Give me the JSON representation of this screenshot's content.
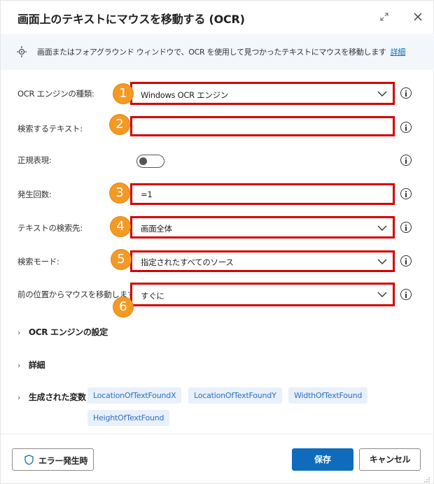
{
  "dialog": {
    "title": "画面上のテキストにマウスを移動する (OCR)",
    "info_text": "画面またはフォアグラウンド ウィンドウで、OCR を使用して見つかったテキストにマウスを移動します",
    "info_link": "詳細"
  },
  "fields": [
    {
      "label": "OCR エンジンの種類:",
      "value": "Windows OCR エンジン",
      "type": "dropdown",
      "badge": "1"
    },
    {
      "label": "検索するテキスト:",
      "value": "",
      "type": "text",
      "badge": "2"
    },
    {
      "label": "正規表現:",
      "value": "",
      "type": "toggle",
      "toggle_on": false
    },
    {
      "label": "発生回数:",
      "value": "=1",
      "type": "text",
      "badge": "3"
    },
    {
      "label": "テキストの検索先:",
      "value": "画面全体",
      "type": "dropdown",
      "badge": "4"
    },
    {
      "label": "検索モード:",
      "value": "指定されたすべてのソース",
      "type": "dropdown",
      "badge": "5"
    },
    {
      "label": "前の位置からマウスを移動します:",
      "value": "すぐに",
      "type": "dropdown",
      "badge": "6"
    }
  ],
  "sections": {
    "ocr_settings": "OCR エンジンの設定",
    "advanced": "詳細",
    "variables": "生成された変数"
  },
  "variables": [
    "LocationOfTextFoundX",
    "LocationOfTextFoundY",
    "WidthOfTextFound",
    "HeightOfTextFound"
  ],
  "footer": {
    "on_error": "エラー発生時",
    "save": "保存",
    "cancel": "キャンセル"
  },
  "colors": {
    "accent": "#0f6cbd",
    "highlight_border": "#d50000",
    "badge": "#f39a25",
    "chip_bg": "#e8f0fb",
    "info_bar_bg": "#f3f6fb"
  },
  "icons": [
    "expand-icon",
    "close-icon",
    "info-bar-icon",
    "chevron-down-icon",
    "help-info-icon",
    "chevron-right-icon",
    "shield-icon"
  ]
}
